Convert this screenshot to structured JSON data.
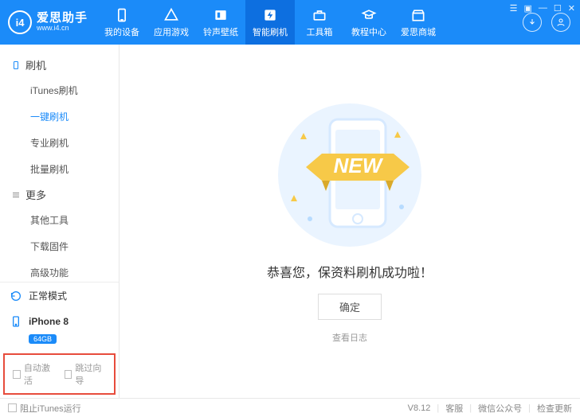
{
  "brand": {
    "logo_text": "i4",
    "title": "爱思助手",
    "subtitle": "www.i4.cn"
  },
  "tabs": [
    {
      "label": "我的设备"
    },
    {
      "label": "应用游戏"
    },
    {
      "label": "铃声壁纸"
    },
    {
      "label": "智能刷机"
    },
    {
      "label": "工具箱"
    },
    {
      "label": "教程中心"
    },
    {
      "label": "爱思商城"
    }
  ],
  "sidebar": {
    "group1": {
      "title": "刷机",
      "items": [
        "iTunes刷机",
        "一键刷机",
        "专业刷机",
        "批量刷机"
      ]
    },
    "group2": {
      "title": "更多",
      "items": [
        "其他工具",
        "下载固件",
        "高级功能"
      ]
    },
    "mode": "正常模式",
    "device": {
      "name": "iPhone 8",
      "storage": "64GB"
    },
    "checks": {
      "auto_activate": "自动激活",
      "skip_guide": "跳过向导"
    }
  },
  "main": {
    "banner_text": "NEW",
    "success": "恭喜您，保资料刷机成功啦！",
    "confirm": "确定",
    "view_log": "查看日志"
  },
  "statusbar": {
    "block_itunes": "阻止iTunes运行",
    "version": "V8.12",
    "support": "客服",
    "wechat": "微信公众号",
    "update": "检查更新"
  }
}
